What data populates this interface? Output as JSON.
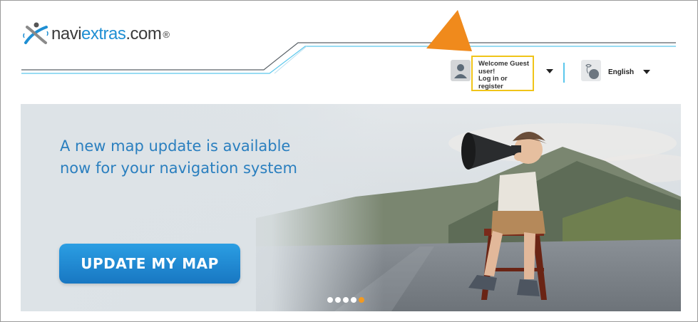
{
  "header": {
    "logo_text_1": "navi",
    "logo_text_2": "extras",
    "logo_text_3": ".com",
    "logo_reg": "®",
    "account": {
      "line1": "Welcome Guest",
      "line2": "user!",
      "line3": "Log in or register"
    },
    "language": {
      "selected": "English"
    }
  },
  "hero": {
    "headline_line1": "A new map update is available",
    "headline_line2": "now for your navigation system",
    "cta_label": "UPDATE MY MAP",
    "carousel_count": 5,
    "carousel_active_index": 4
  },
  "colors": {
    "brand_blue": "#1f8fd3",
    "accent_orange": "#f39a21",
    "highlight_yellow": "#f0c419",
    "line_cyan": "#5bc7ec"
  },
  "icons": [
    "logo-mark-icon",
    "user-avatar-icon",
    "caret-down-icon",
    "globe-icon",
    "annotation-arrow"
  ]
}
